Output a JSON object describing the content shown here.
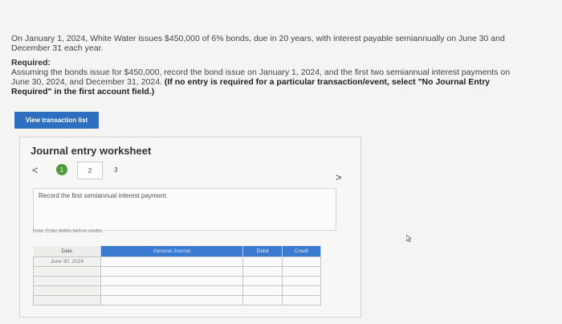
{
  "problem": {
    "text": "On January 1, 2024, White Water issues $450,000 of 6% bonds, due in 20 years, with interest payable semiannually on June 30 and December 31 each year."
  },
  "required": {
    "heading": "Required:",
    "text": "Assuming the bonds issue for $450,000, record the bond issue on January 1, 2024, and the first two semiannual interest payments on June 30, 2024, and December 31, 2024.",
    "note_bold": "(If no entry is required for a particular transaction/event, select \"No Journal Entry Required\" in the first account field.)"
  },
  "view_button_label": "View transaction list",
  "worksheet": {
    "title": "Journal entry worksheet",
    "prev_glyph": "<",
    "next_glyph": ">",
    "steps": [
      "1",
      "2",
      "3"
    ],
    "instruction": "Record the first semiannual interest payment.",
    "note": "Note: Enter debits before credits."
  },
  "table": {
    "headers": [
      "Date",
      "General Journal",
      "Debit",
      "Credit"
    ],
    "rows": [
      [
        "June 30, 2024",
        "",
        "",
        ""
      ],
      [
        "",
        "",
        "",
        ""
      ],
      [
        "",
        "",
        "",
        ""
      ],
      [
        "",
        "",
        "",
        ""
      ],
      [
        "",
        "",
        "",
        ""
      ]
    ]
  }
}
